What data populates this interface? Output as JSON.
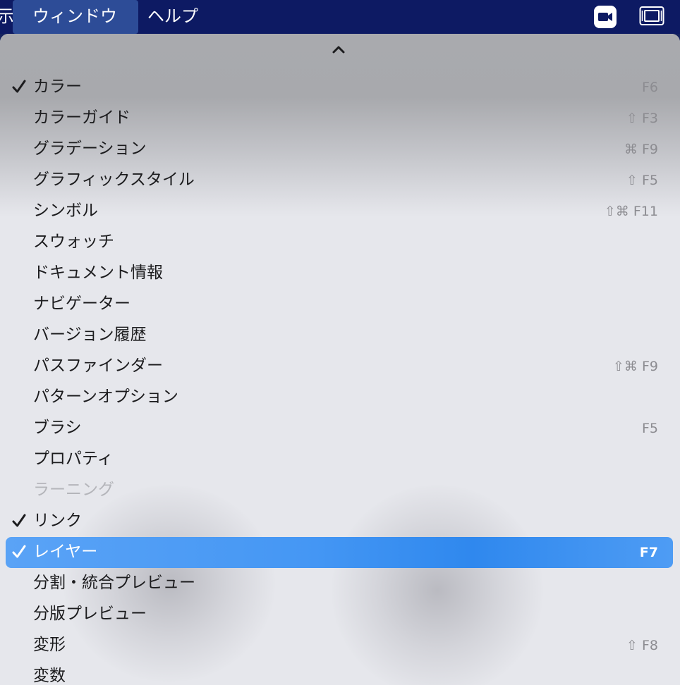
{
  "menubar": {
    "edge_char": "示",
    "items": [
      {
        "label": "ウィンドウ",
        "active": true
      },
      {
        "label": "ヘルプ",
        "active": false
      }
    ],
    "status_icons": [
      "video-camera-icon",
      "screen-mirroring-icon"
    ]
  },
  "menu": {
    "scroll_up_icon": "chevron-up-icon",
    "items": [
      {
        "label": "カラー",
        "shortcut": "F6",
        "checked": true
      },
      {
        "label": "カラーガイド",
        "shortcut": "⇧ F3",
        "checked": false
      },
      {
        "label": "グラデーション",
        "shortcut": "⌘ F9",
        "checked": false
      },
      {
        "label": "グラフィックスタイル",
        "shortcut": "⇧ F5",
        "checked": false
      },
      {
        "label": "シンボル",
        "shortcut": "⇧⌘ F11",
        "checked": false
      },
      {
        "label": "スウォッチ",
        "shortcut": "",
        "checked": false
      },
      {
        "label": "ドキュメント情報",
        "shortcut": "",
        "checked": false
      },
      {
        "label": "ナビゲーター",
        "shortcut": "",
        "checked": false
      },
      {
        "label": "バージョン履歴",
        "shortcut": "",
        "checked": false
      },
      {
        "label": "パスファインダー",
        "shortcut": "⇧⌘ F9",
        "checked": false
      },
      {
        "label": "パターンオプション",
        "shortcut": "",
        "checked": false
      },
      {
        "label": "ブラシ",
        "shortcut": "F5",
        "checked": false
      },
      {
        "label": "プロパティ",
        "shortcut": "",
        "checked": false
      },
      {
        "label": "ラーニング",
        "shortcut": "",
        "checked": false,
        "disabled": true
      },
      {
        "label": "リンク",
        "shortcut": "",
        "checked": true
      },
      {
        "label": "レイヤー",
        "shortcut": "F7",
        "checked": true,
        "selected": true
      },
      {
        "label": "分割・統合プレビュー",
        "shortcut": "",
        "checked": false
      },
      {
        "label": "分版プレビュー",
        "shortcut": "",
        "checked": false
      },
      {
        "label": "変形",
        "shortcut": "⇧ F8",
        "checked": false
      },
      {
        "label": "変数",
        "shortcut": "",
        "checked": false
      }
    ]
  },
  "colors": {
    "menubar_bg": "#0d1a63",
    "active_menu_bg": "#2d4c97",
    "selection_blue": "#4597f4",
    "menu_bg": "#e6e7ec",
    "shortcut_gray": "#8c8c91",
    "disabled_gray": "#b4b5ba"
  }
}
